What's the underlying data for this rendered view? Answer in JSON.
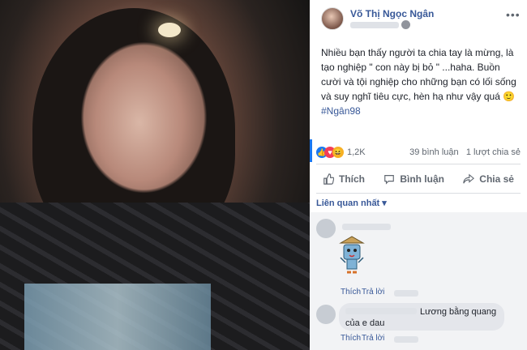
{
  "post": {
    "author": "Võ Thị Ngọc Ngân",
    "more": "•••",
    "body": "Nhiều bạn thấy người ta chia tay là mừng, là tạo nghiệp \" con này bị bỏ \" ...haha. Buồn cười và tội nghiệp cho những bạn có lối sống và suy nghĩ tiêu cực, hèn hạ như vậy quá 🙂",
    "hashtag": "#Ngân98"
  },
  "reactions": {
    "count": "1,2K",
    "comments": "39 bình luận",
    "shares": "1 lượt chia sẻ"
  },
  "actions": {
    "like": "Thích",
    "comment": "Bình luận",
    "share": "Chia sẻ"
  },
  "comments": {
    "sort_label": "Liên quan nhất ▾",
    "c1": {
      "like": "Thích",
      "reply": "Trả lời"
    },
    "c2": {
      "text": "Lương bằng quang của e dau",
      "like": "Thích",
      "reply": "Trả lời"
    }
  },
  "colors": {
    "link": "#385898",
    "muted": "#606770",
    "accent": "#1877f2"
  }
}
